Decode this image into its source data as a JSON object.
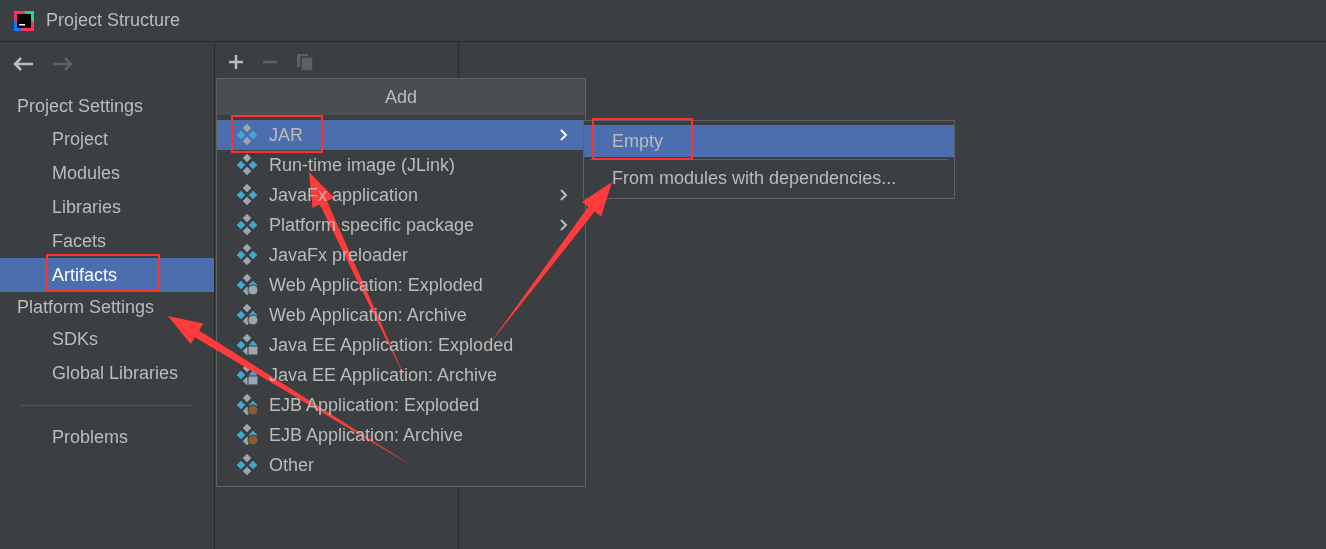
{
  "window": {
    "title": "Project Structure"
  },
  "sidebar": {
    "sections": [
      {
        "label": "Project Settings",
        "items": [
          {
            "label": "Project",
            "selected": false
          },
          {
            "label": "Modules",
            "selected": false
          },
          {
            "label": "Libraries",
            "selected": false
          },
          {
            "label": "Facets",
            "selected": false
          },
          {
            "label": "Artifacts",
            "selected": true
          }
        ]
      },
      {
        "label": "Platform Settings",
        "items": [
          {
            "label": "SDKs",
            "selected": false
          },
          {
            "label": "Global Libraries",
            "selected": false
          }
        ]
      }
    ],
    "problems": {
      "label": "Problems",
      "selected": false
    }
  },
  "popup": {
    "title": "Add",
    "items": [
      {
        "label": "JAR",
        "kind": "plain",
        "submenu": true,
        "selected": true
      },
      {
        "label": "Run-time image (JLink)",
        "kind": "plain",
        "submenu": false,
        "selected": false
      },
      {
        "label": "JavaFx application",
        "kind": "plain",
        "submenu": true,
        "selected": false
      },
      {
        "label": "Platform specific package",
        "kind": "plain",
        "submenu": true,
        "selected": false
      },
      {
        "label": "JavaFx preloader",
        "kind": "plain",
        "submenu": false,
        "selected": false
      },
      {
        "label": "Web Application: Exploded",
        "kind": "web",
        "submenu": false,
        "selected": false
      },
      {
        "label": "Web Application: Archive",
        "kind": "web",
        "submenu": false,
        "selected": false
      },
      {
        "label": "Java EE Application: Exploded",
        "kind": "javaee",
        "submenu": false,
        "selected": false
      },
      {
        "label": "Java EE Application: Archive",
        "kind": "javaee",
        "submenu": false,
        "selected": false
      },
      {
        "label": "EJB Application: Exploded",
        "kind": "ejb",
        "submenu": false,
        "selected": false
      },
      {
        "label": "EJB Application: Archive",
        "kind": "ejb",
        "submenu": false,
        "selected": false
      },
      {
        "label": "Other",
        "kind": "plain",
        "submenu": false,
        "selected": false
      }
    ]
  },
  "submenu": {
    "items": [
      {
        "label": "Empty",
        "selected": true
      },
      {
        "label": "From modules with dependencies...",
        "selected": false
      }
    ]
  }
}
